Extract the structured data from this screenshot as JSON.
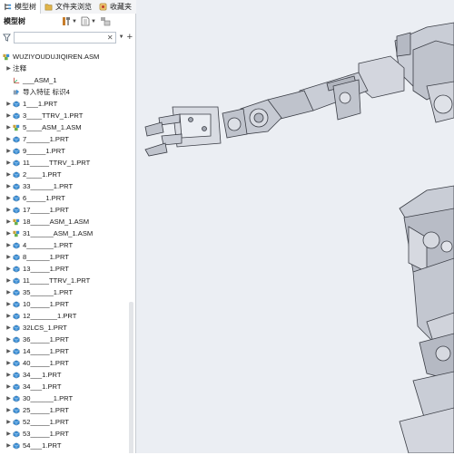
{
  "tabs": [
    {
      "label": "模型树",
      "icon": "model-tree-icon"
    },
    {
      "label": "文件夹浏览",
      "icon": "folder-icon"
    },
    {
      "label": "收藏夹",
      "icon": "favorites-icon"
    }
  ],
  "toolbar": {
    "title": "模型树"
  },
  "search": {
    "value": "",
    "placeholder": ""
  },
  "tree": {
    "root": "WUZIYOUDUJIQIREN.ASM",
    "notes_label": "注释",
    "items": [
      {
        "label": "___ASM_1",
        "icon": "csys-icon",
        "exp": false
      },
      {
        "label": "导入特征 标识4",
        "icon": "import-feature-icon",
        "exp": false
      },
      {
        "label": "1___1.PRT",
        "icon": "part-icon",
        "exp": true
      },
      {
        "label": "3____TTRV_1.PRT",
        "icon": "part-icon",
        "exp": true
      },
      {
        "label": "5____ASM_1.ASM",
        "icon": "assembly-icon",
        "exp": true
      },
      {
        "label": "7______1.PRT",
        "icon": "part-icon",
        "exp": true
      },
      {
        "label": "9_____1.PRT",
        "icon": "part-icon",
        "exp": true
      },
      {
        "label": "11_____TTRV_1.PRT",
        "icon": "part-icon",
        "exp": true
      },
      {
        "label": "2____1.PRT",
        "icon": "part-icon",
        "exp": true
      },
      {
        "label": "33______1.PRT",
        "icon": "part-icon",
        "exp": true
      },
      {
        "label": "6_____1.PRT",
        "icon": "part-icon",
        "exp": true
      },
      {
        "label": "17_____1.PRT",
        "icon": "part-icon",
        "exp": true
      },
      {
        "label": "18_____ASM_1.ASM",
        "icon": "assembly-icon",
        "exp": true
      },
      {
        "label": "31______ASM_1.ASM",
        "icon": "assembly-icon",
        "exp": true
      },
      {
        "label": "4_______1.PRT",
        "icon": "part-icon",
        "exp": true
      },
      {
        "label": "8______1.PRT",
        "icon": "part-icon",
        "exp": true
      },
      {
        "label": "13_____1.PRT",
        "icon": "part-icon",
        "exp": true
      },
      {
        "label": "11_____TTRV_1.PRT",
        "icon": "part-icon",
        "exp": true
      },
      {
        "label": "35______1.PRT",
        "icon": "part-icon",
        "exp": true
      },
      {
        "label": "10_____1.PRT",
        "icon": "part-icon",
        "exp": true
      },
      {
        "label": "12_______1.PRT",
        "icon": "part-icon",
        "exp": true
      },
      {
        "label": "32LCS_1.PRT",
        "icon": "part-icon",
        "exp": true
      },
      {
        "label": "36_____1.PRT",
        "icon": "part-icon",
        "exp": true
      },
      {
        "label": "14_____1.PRT",
        "icon": "part-icon",
        "exp": true
      },
      {
        "label": "40_____1.PRT",
        "icon": "part-icon",
        "exp": true
      },
      {
        "label": "34___1.PRT",
        "icon": "part-icon",
        "exp": true
      },
      {
        "label": "34___1.PRT",
        "icon": "part-icon",
        "exp": true
      },
      {
        "label": "30______1.PRT",
        "icon": "part-icon",
        "exp": true
      },
      {
        "label": "25_____1.PRT",
        "icon": "part-icon",
        "exp": true
      },
      {
        "label": "52_____1.PRT",
        "icon": "part-icon",
        "exp": true
      },
      {
        "label": "53_____1.PRT",
        "icon": "part-icon",
        "exp": true
      },
      {
        "label": "54___1.PRT",
        "icon": "part-icon",
        "exp": true
      }
    ]
  },
  "colors": {
    "part": "#3b8fd6",
    "assembly": "#c8a23c",
    "viewport_bg": "#ebeef3",
    "robot": "#c9cdd6",
    "robot_edge": "#3a3d45"
  }
}
